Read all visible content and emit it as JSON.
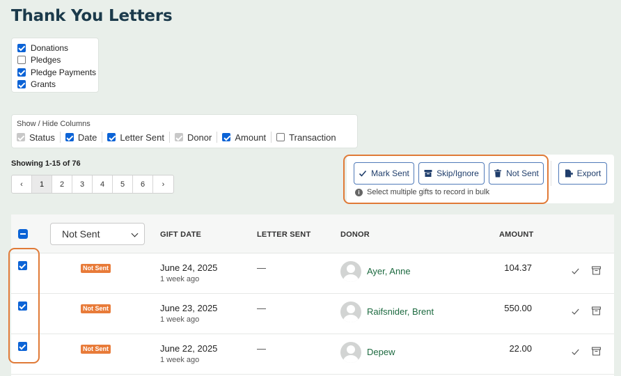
{
  "page": {
    "title": "Thank You Letters"
  },
  "types": [
    {
      "label": "Donations",
      "checked": true
    },
    {
      "label": "Pledges",
      "checked": false
    },
    {
      "label": "Pledge Payments",
      "checked": true
    },
    {
      "label": "Grants",
      "checked": true
    }
  ],
  "columns": {
    "title": "Show / Hide Columns",
    "items": [
      {
        "label": "Status",
        "state": "disabled"
      },
      {
        "label": "Date",
        "state": "on"
      },
      {
        "label": "Letter Sent",
        "state": "on"
      },
      {
        "label": "Donor",
        "state": "disabled"
      },
      {
        "label": "Amount",
        "state": "on"
      },
      {
        "label": "Transaction",
        "state": "off"
      }
    ]
  },
  "showing": "Showing 1-15 of 76",
  "pagination": {
    "prev": "‹",
    "next": "›",
    "pages": [
      "1",
      "2",
      "3",
      "4",
      "5",
      "6"
    ],
    "current": "1"
  },
  "actions": {
    "mark_sent": "Mark Sent",
    "skip_ignore": "Skip/Ignore",
    "not_sent": "Not Sent",
    "export": "Export",
    "hint": "Select multiple gifts to record in bulk"
  },
  "table": {
    "status_filter": "Not Sent",
    "headers": {
      "gift_date": "GIFT DATE",
      "letter_sent": "LETTER SENT",
      "donor": "DONOR",
      "amount": "AMOUNT"
    },
    "rows": [
      {
        "status": "Not Sent",
        "date": "June 24, 2025",
        "ago": "1 week ago",
        "letter_sent": "—",
        "donor": "Ayer, Anne",
        "amount": "104.37"
      },
      {
        "status": "Not Sent",
        "date": "June 23, 2025",
        "ago": "1 week ago",
        "letter_sent": "—",
        "donor": "Raifsnider, Brent",
        "amount": "550.00"
      },
      {
        "status": "Not Sent",
        "date": "June 22, 2025",
        "ago": "1 week ago",
        "letter_sent": "—",
        "donor": "Depew",
        "amount": "22.00"
      }
    ]
  },
  "colors": {
    "accent": "#0b63d6",
    "highlight": "#e07a37",
    "badge": "#e87b39",
    "donor_link": "#1d6a40",
    "title": "#1b3a4b"
  }
}
